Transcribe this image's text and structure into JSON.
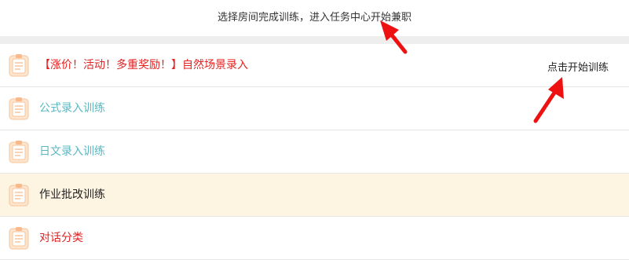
{
  "header": {
    "instruction": "选择房间完成训练，进入任务中心开始兼职"
  },
  "list": {
    "items": [
      {
        "label": "【涨价！活动！多重奖励！】自然场景录入",
        "color": "#e32222"
      },
      {
        "label": "公式录入训练",
        "color": "#5ab7c1"
      },
      {
        "label": "日文录入训练",
        "color": "#5ab7c1"
      },
      {
        "label": "作业批改训练",
        "color": "#222222"
      },
      {
        "label": "对话分类",
        "color": "#e32222"
      }
    ]
  },
  "annotation": {
    "start_hint": "点击开始训练",
    "arrow_color": "#ee1111"
  },
  "icons": {
    "row_icon": "clipboard-icon",
    "arrow": "red-arrow"
  },
  "colors": {
    "highlight_row": "#fdf4e1",
    "band": "#eeeeee"
  }
}
